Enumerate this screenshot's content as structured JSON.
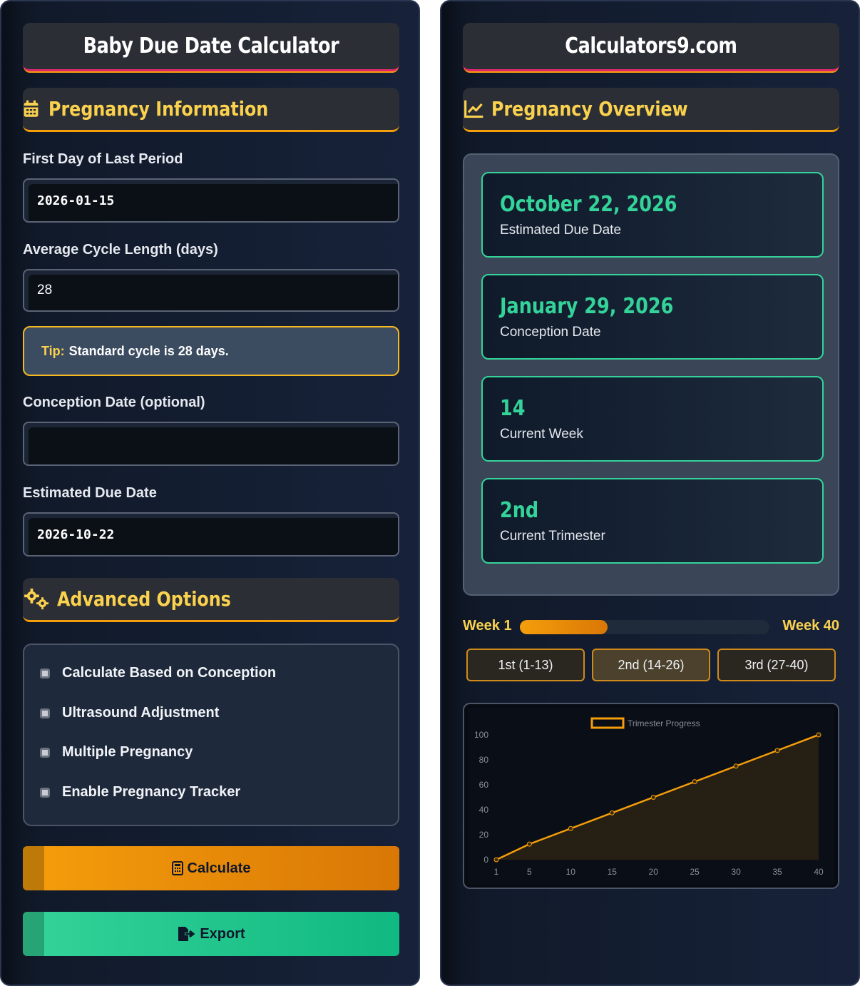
{
  "left": {
    "title": "Baby Due Date Calculator",
    "section_info": "Pregnancy Information",
    "lmp_label": "First Day of Last Period",
    "lmp_value": "2026-01-15",
    "cycle_label": "Average Cycle Length (days)",
    "cycle_value": "28",
    "tip_key": "Tip:",
    "tip_text": "Standard cycle is 28 days.",
    "conception_label": "Conception Date (optional)",
    "conception_value": "",
    "due_label": "Estimated Due Date",
    "due_value": "2026-10-22",
    "section_advanced": "Advanced Options",
    "options": [
      "Calculate Based on Conception",
      "Ultrasound Adjustment",
      "Multiple Pregnancy",
      "Enable Pregnancy Tracker"
    ],
    "calculate_label": "Calculate",
    "export_label": "Export"
  },
  "right": {
    "title": "Calculators9.com",
    "section_overview": "Pregnancy Overview",
    "cards": [
      {
        "value": "October 22, 2026",
        "caption": "Estimated Due Date"
      },
      {
        "value": "January 29, 2026",
        "caption": "Conception Date"
      },
      {
        "value": "14",
        "caption": "Current Week"
      },
      {
        "value": "2nd",
        "caption": "Current Trimester"
      }
    ],
    "week_start": "Week 1",
    "week_end": "Week 40",
    "progress_fraction": 0.35,
    "trimesters": [
      "1st (1-13)",
      "2nd (14-26)",
      "3rd (27-40)"
    ],
    "active_trimester": 1
  },
  "colors": {
    "accent_gold": "#fbd24e",
    "accent_orange": "#f59e0b",
    "accent_green": "#34d399",
    "title_underline": "#e0266e"
  },
  "chart_data": {
    "type": "line",
    "legend": "Trimester Progress",
    "x": [
      1,
      5,
      10,
      15,
      20,
      25,
      30,
      35,
      40
    ],
    "series": [
      {
        "name": "Trimester Progress",
        "values": [
          0,
          12.5,
          25,
          37.5,
          50,
          62.5,
          75,
          87.5,
          100
        ]
      }
    ],
    "xticks": [
      "1",
      "5",
      "10",
      "15",
      "20",
      "25",
      "30",
      "35",
      "40"
    ],
    "yticks": [
      "0",
      "20",
      "40",
      "60",
      "80",
      "100"
    ],
    "ylim": [
      0,
      100
    ],
    "xlim": [
      1,
      40
    ],
    "grid": false,
    "legend_position": "top-center",
    "line_color": "#f59e0b"
  }
}
